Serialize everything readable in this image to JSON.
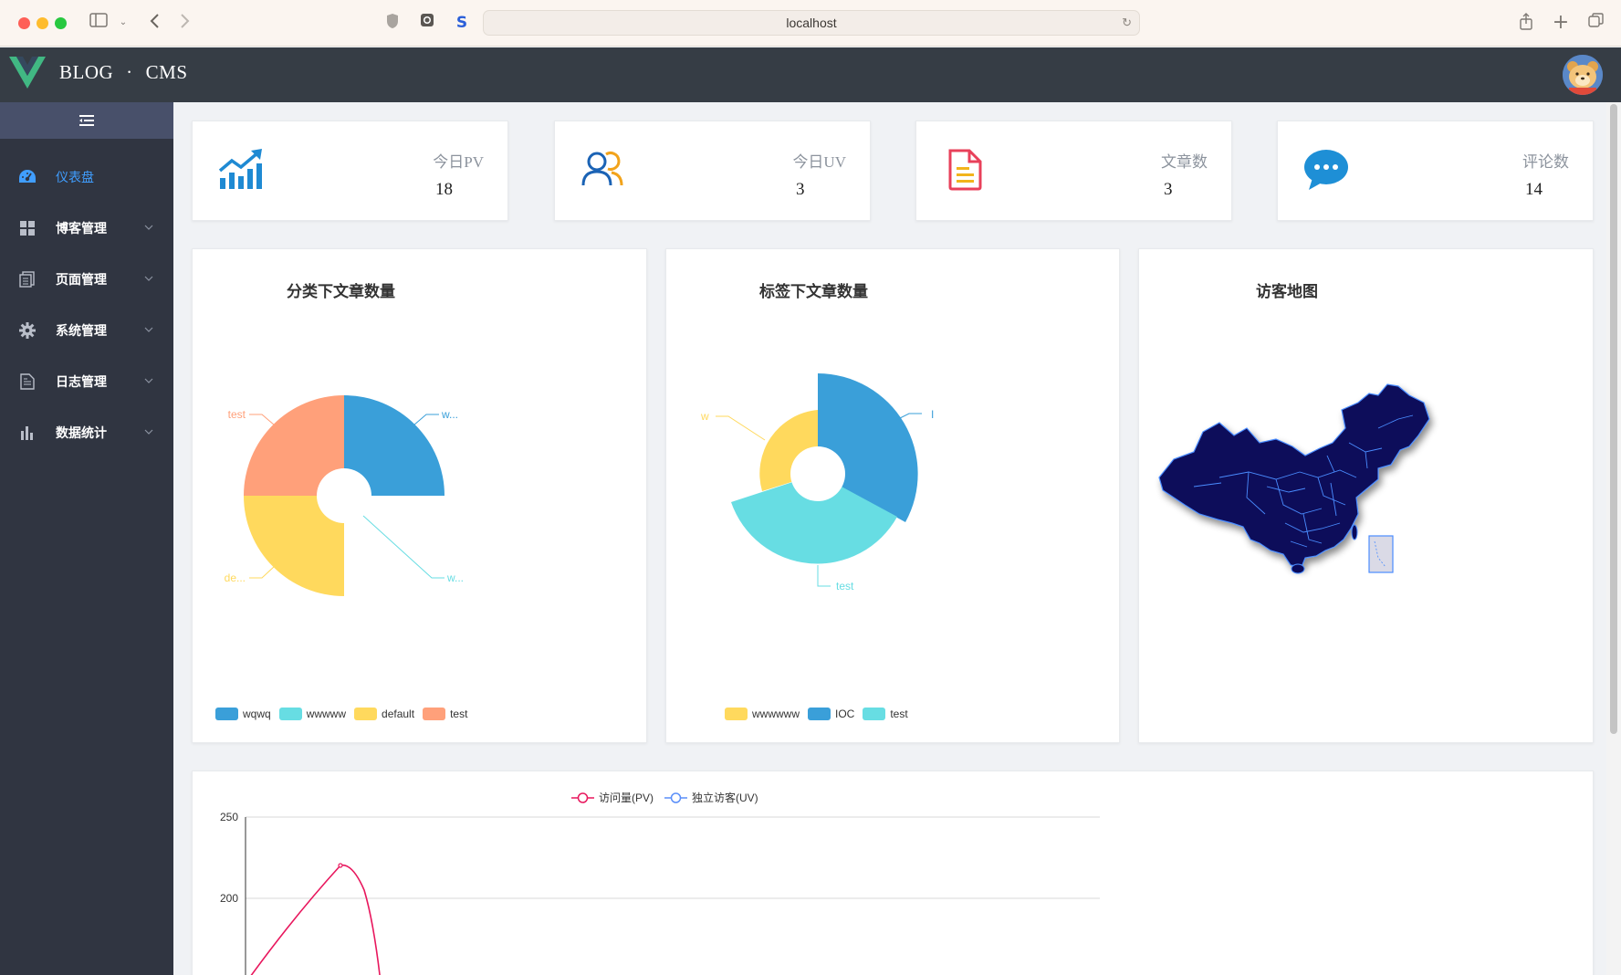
{
  "browser": {
    "url": "localhost"
  },
  "header": {
    "brand_left": "BLOG",
    "brand_dot": "·",
    "brand_right": "CMS"
  },
  "sidebar": {
    "items": [
      {
        "label": "仪表盘",
        "icon": "dashboard-icon",
        "active": true
      },
      {
        "label": "博客管理",
        "icon": "grid-icon"
      },
      {
        "label": "页面管理",
        "icon": "pages-icon"
      },
      {
        "label": "系统管理",
        "icon": "gear-icon"
      },
      {
        "label": "日志管理",
        "icon": "document-icon"
      },
      {
        "label": "数据统计",
        "icon": "bar-chart-icon"
      }
    ]
  },
  "stats": [
    {
      "label": "今日PV",
      "value": "18",
      "icon": "trend-chart-icon",
      "color": "#1f8ad3"
    },
    {
      "label": "今日UV",
      "value": "3",
      "icon": "users-icon",
      "color": "#1b63b5"
    },
    {
      "label": "文章数",
      "value": "3",
      "icon": "article-icon",
      "color": "#e8405a"
    },
    {
      "label": "评论数",
      "value": "14",
      "icon": "comment-icon",
      "color": "#1e8fd6"
    }
  ],
  "category_chart": {
    "title": "分类下文章数量",
    "labels": {
      "wqwq": "w...",
      "wwwww": "w...",
      "default": "de...",
      "test": "test"
    },
    "legend": [
      {
        "name": "wqwq",
        "color": "#3a9fd9"
      },
      {
        "name": "wwwww",
        "color": "#67dde3"
      },
      {
        "name": "default",
        "color": "#ffd95d"
      },
      {
        "name": "test",
        "color": "#ffa07a"
      }
    ]
  },
  "tag_chart": {
    "title": "标签下文章数量",
    "labels": {
      "IOC": "I",
      "test": "test",
      "wwwwww": "w"
    },
    "legend": [
      {
        "name": "wwwwww",
        "color": "#ffd95d"
      },
      {
        "name": "IOC",
        "color": "#3a9fd9"
      },
      {
        "name": "test",
        "color": "#67dde3"
      }
    ]
  },
  "map_card": {
    "title": "访客地图"
  },
  "chart_data": [
    {
      "type": "pie",
      "title": "分类下文章数量",
      "categories": [
        "wqwq",
        "wwwww",
        "default",
        "test"
      ],
      "values": [
        1,
        0,
        1,
        1
      ]
    },
    {
      "type": "pie",
      "title": "标签下文章数量",
      "categories": [
        "wwwwww",
        "IOC",
        "test"
      ],
      "values": [
        1,
        1.2,
        1.35
      ]
    },
    {
      "type": "line",
      "series": [
        {
          "name": "访问量(PV)",
          "color": "#e8175d"
        },
        {
          "name": "独立访客(UV)",
          "color": "#5b8ff9"
        }
      ],
      "y_ticks": [
        "250",
        "200"
      ],
      "ylim": [
        150,
        250
      ]
    }
  ]
}
